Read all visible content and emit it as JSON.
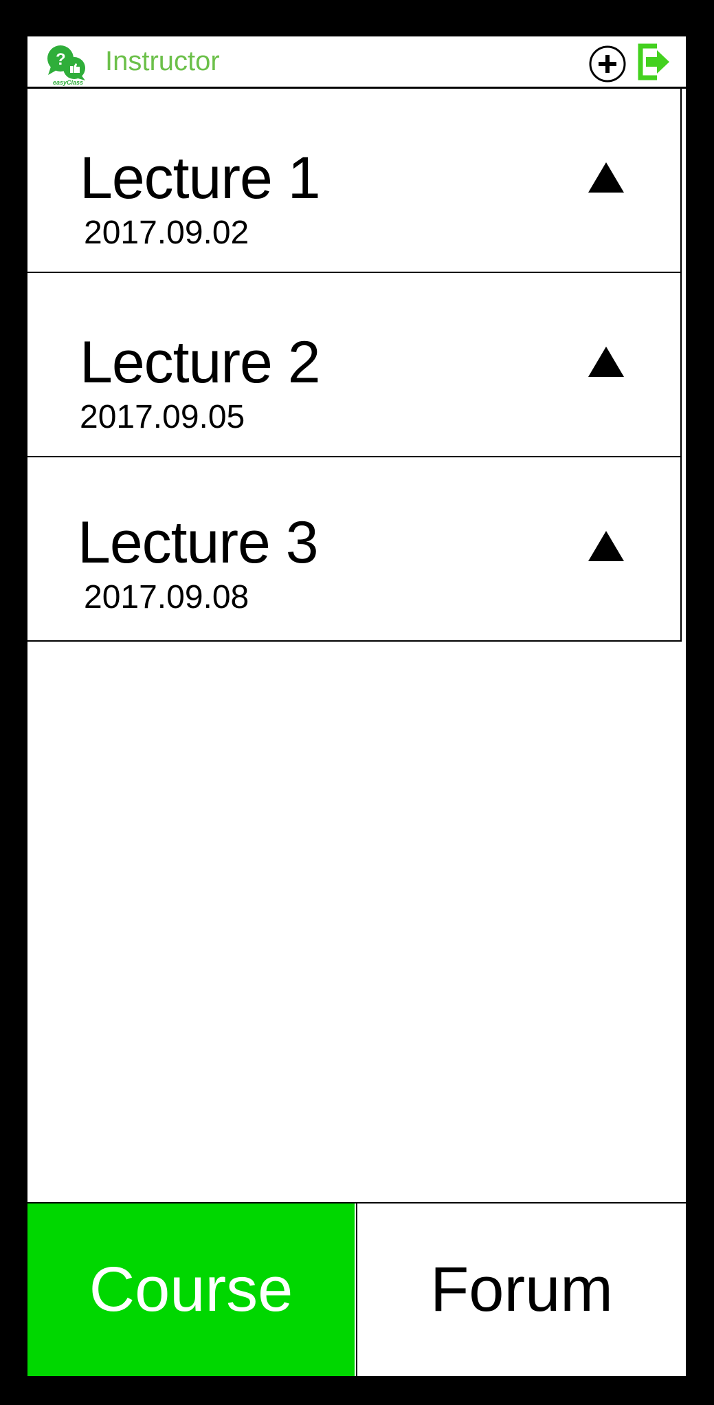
{
  "header": {
    "title": "Instructor",
    "logo_text": "easyClass",
    "add_icon": "plus-circle-icon",
    "logout_icon": "logout-icon",
    "accent_color": "#6cc04a"
  },
  "lectures": [
    {
      "title": "Lecture 1",
      "date": "2017.09.02",
      "icon": "triangle-up-icon"
    },
    {
      "title": "Lecture 2",
      "date": "2017.09.05",
      "icon": "triangle-up-icon"
    },
    {
      "title": "Lecture 3",
      "date": "2017.09.08",
      "icon": "triangle-up-icon"
    }
  ],
  "tabs": [
    {
      "label": "Course",
      "active": true,
      "color": "#00d700"
    },
    {
      "label": "Forum",
      "active": false
    }
  ]
}
